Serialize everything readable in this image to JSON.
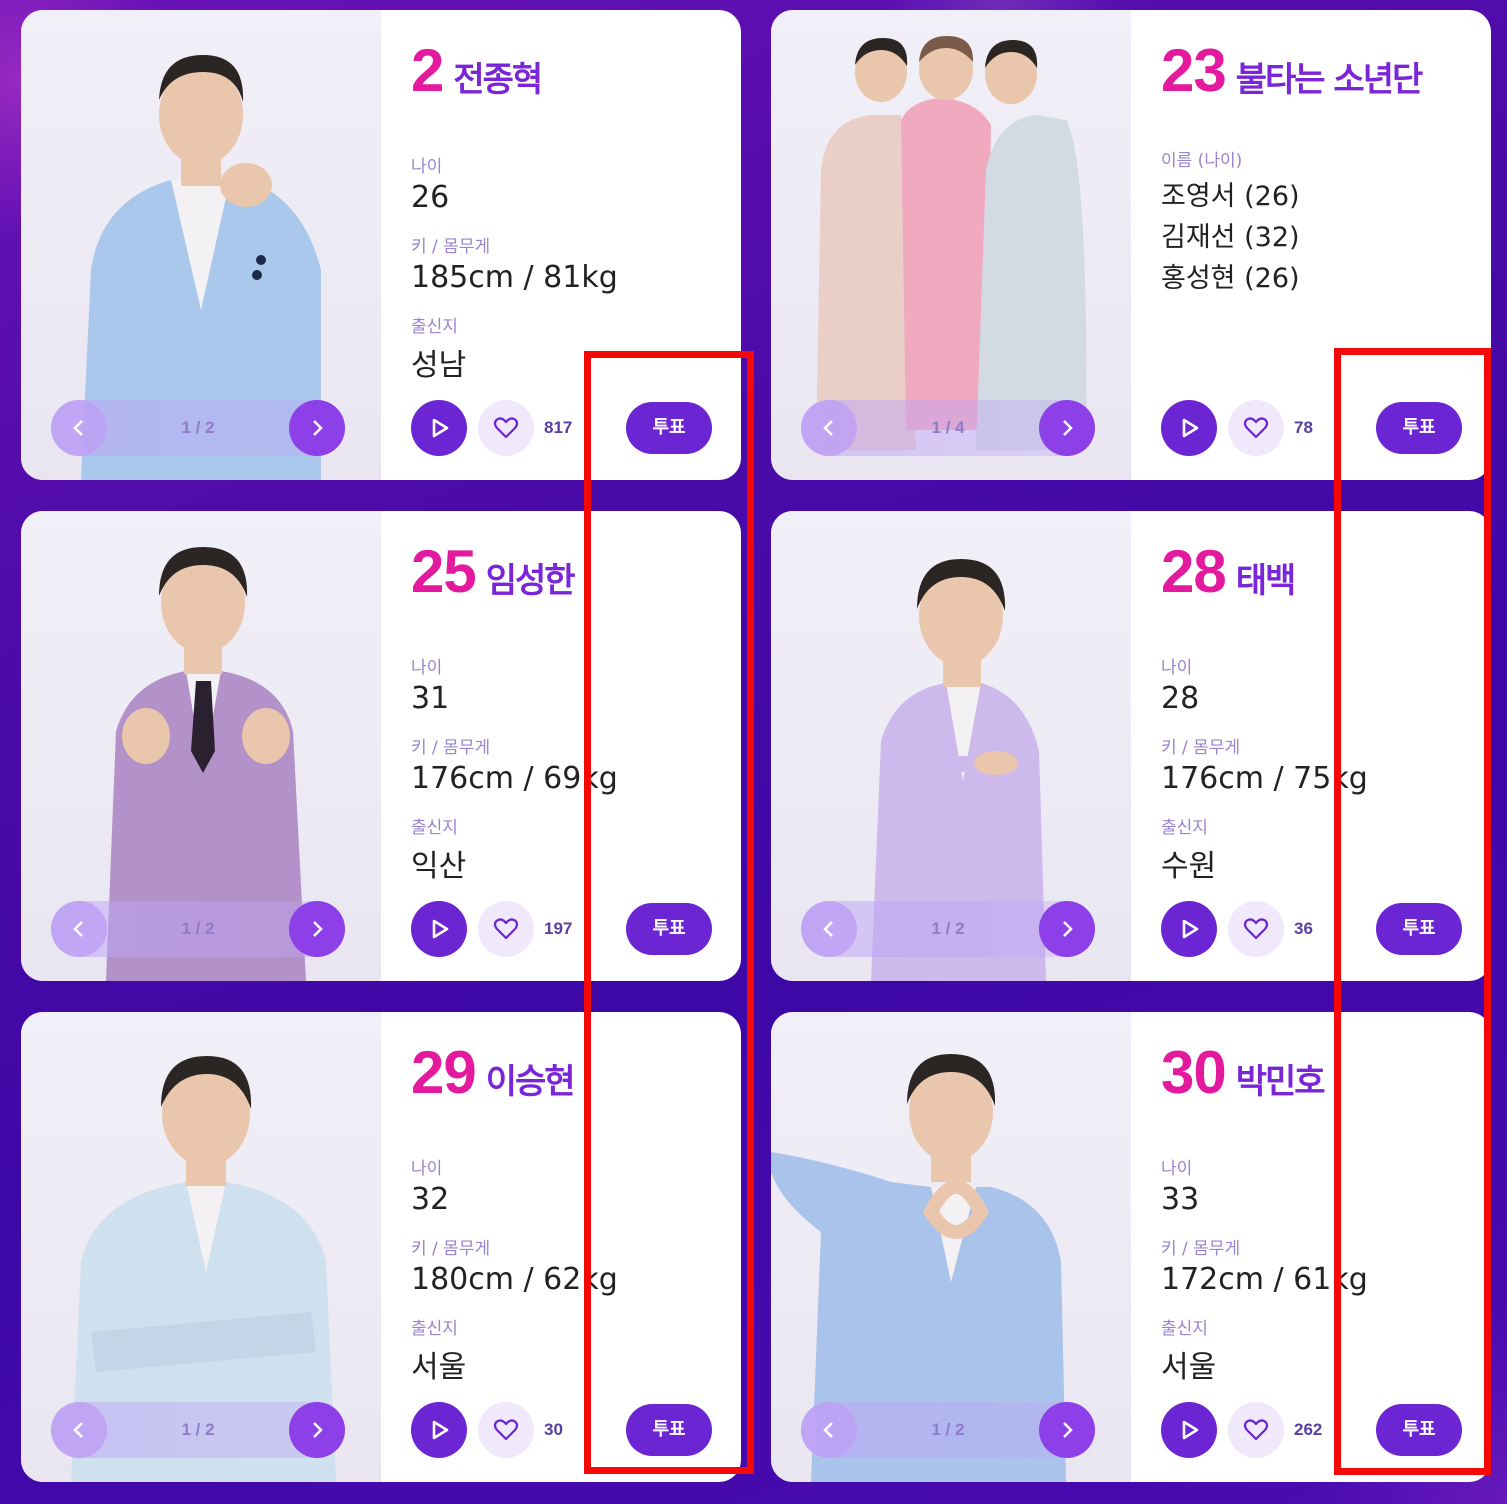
{
  "cards": [
    {
      "number": "2",
      "name": "전종혁",
      "info": [
        {
          "label": "나이",
          "value": "26"
        },
        {
          "label": "키 / 몸무게",
          "value": "185cm / 81kg"
        },
        {
          "label": "출신지",
          "value": "성남"
        }
      ],
      "pager": "1 / 2",
      "likes": "817",
      "vote_label": "투표",
      "suit_color": "#a9c8ec"
    },
    {
      "number": "23",
      "name": "불타는 소년단",
      "info_label": "이름 (나이)",
      "members": [
        "조영서 (26)",
        "김재선 (32)",
        "홍성현 (26)"
      ],
      "pager": "1 / 4",
      "likes": "78",
      "vote_label": "투표",
      "suit_colors": [
        "#e9cfc7",
        "#f1a9bf",
        "#d2dbe4"
      ]
    },
    {
      "number": "25",
      "name": "임성한",
      "info": [
        {
          "label": "나이",
          "value": "31"
        },
        {
          "label": "키 / 몸무게",
          "value": "176cm / 69kg"
        },
        {
          "label": "출신지",
          "value": "익산"
        }
      ],
      "pager": "1 / 2",
      "likes": "197",
      "vote_label": "투표",
      "suit_color": "#b392c9"
    },
    {
      "number": "28",
      "name": "태백",
      "info": [
        {
          "label": "나이",
          "value": "28"
        },
        {
          "label": "키 / 몸무게",
          "value": "176cm / 75kg"
        },
        {
          "label": "출신지",
          "value": "수원"
        }
      ],
      "pager": "1 / 2",
      "likes": "36",
      "vote_label": "투표",
      "suit_color": "#cdb9ec"
    },
    {
      "number": "29",
      "name": "이승현",
      "info": [
        {
          "label": "나이",
          "value": "32"
        },
        {
          "label": "키 / 몸무게",
          "value": "180cm / 62kg"
        },
        {
          "label": "출신지",
          "value": "서울"
        }
      ],
      "pager": "1 / 2",
      "likes": "30",
      "vote_label": "투표",
      "suit_color": "#cfe0ee"
    },
    {
      "number": "30",
      "name": "박민호",
      "info": [
        {
          "label": "나이",
          "value": "33"
        },
        {
          "label": "키 / 몸무게",
          "value": "172cm / 61kg"
        },
        {
          "label": "출신지",
          "value": "서울"
        }
      ],
      "pager": "1 / 2",
      "likes": "262",
      "vote_label": "투표",
      "suit_color": "#a9c3ea"
    }
  ],
  "icons": {
    "play": "play-icon",
    "heart": "heart-icon",
    "prev": "chevron-left-icon",
    "next": "chevron-right-icon"
  },
  "colors": {
    "accent_number": "#e3199e",
    "accent_name": "#7a25d8",
    "button": "#6c25d3",
    "highlight": "#f40808"
  }
}
